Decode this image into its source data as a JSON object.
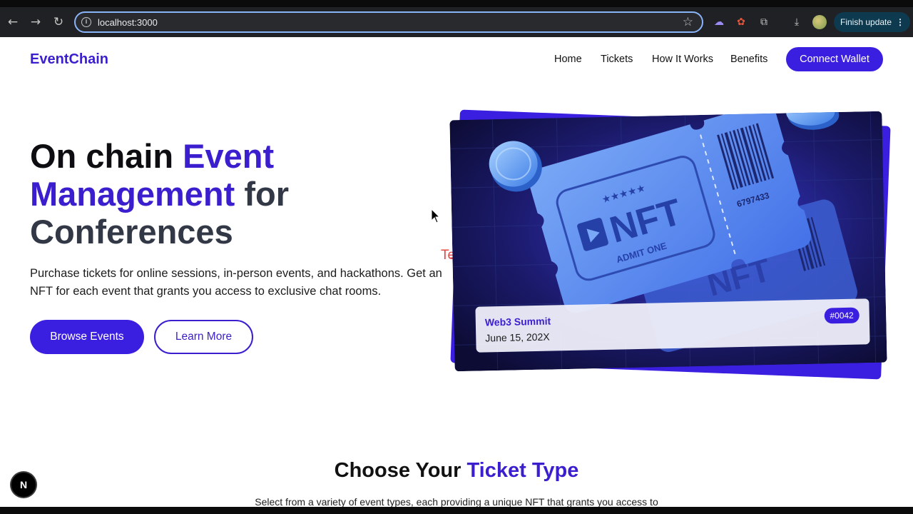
{
  "browser": {
    "url": "localhost:3000",
    "finish_update": "Finish update"
  },
  "site": {
    "logo": "EventChain",
    "nav": [
      "Home",
      "Tickets",
      "How It Works",
      "Benefits"
    ],
    "connect_wallet": "Connect Wallet"
  },
  "hero": {
    "title_part1": "On chain ",
    "title_accent": "Event Management",
    "title_part2": " for",
    "title_part3": "Conferences",
    "description": "Purchase tickets for online sessions, in-person events, and hackathons. Get an NFT for each event that grants you access to exclusive chat rooms.",
    "browse_button": "Browse Events",
    "learn_button": "Learn More",
    "overlay_text": "Text",
    "ticket_image": {
      "nft_label": "NFT",
      "admit": "ADMIT ONE",
      "serial": "6797433",
      "stars": "★★★★★"
    },
    "ticket_info": {
      "event_name": "Web3 Summit",
      "date": "June 15, 202X",
      "id": "#0042"
    }
  },
  "section": {
    "title_part1": "Choose Your ",
    "title_accent": "Ticket Type",
    "description": "Select from a variety of event types, each providing a unique NFT that grants you access to"
  },
  "framework_badge": "N"
}
